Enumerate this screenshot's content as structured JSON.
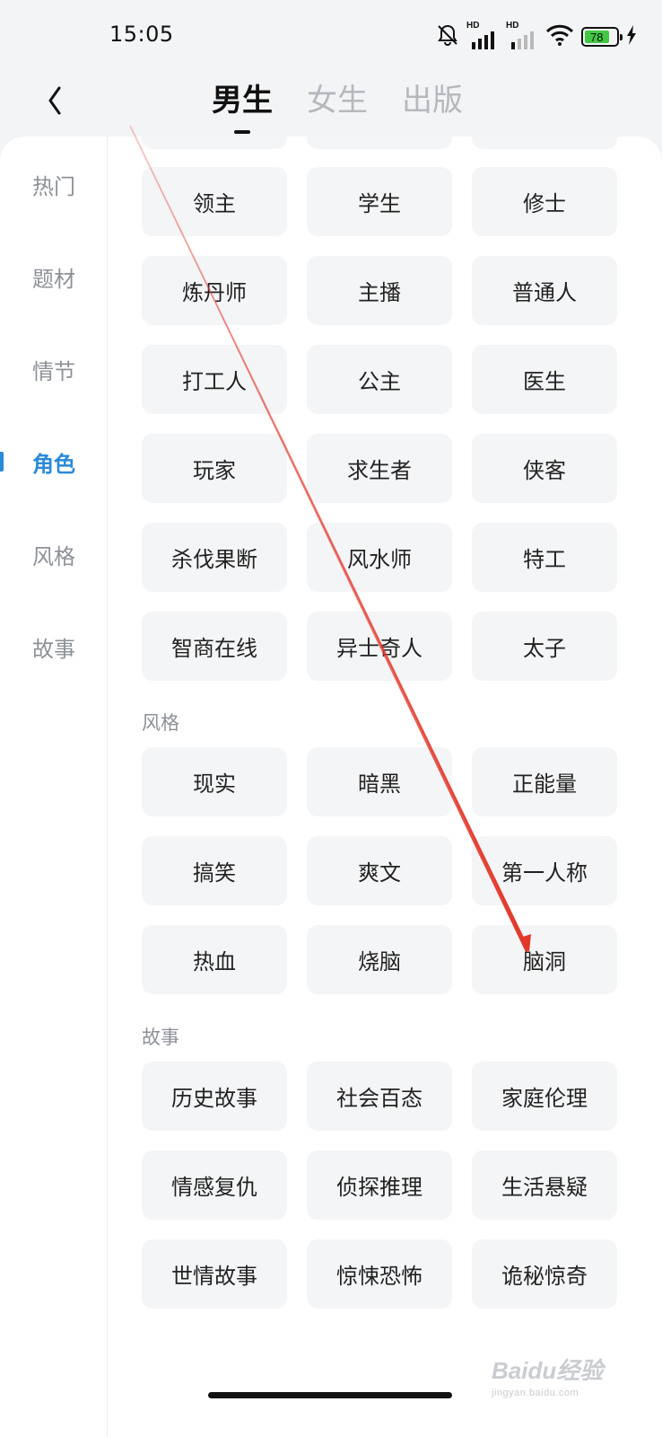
{
  "status_bar": {
    "time": "15:05",
    "signal_label_1": "HD",
    "signal_label_2": "HD",
    "battery_level": "78",
    "icons": [
      "silent-bell-icon",
      "signal-icon",
      "signal-icon",
      "wifi-icon",
      "battery-icon",
      "charging-icon"
    ]
  },
  "header": {
    "back_icon": "chevron-left-icon",
    "tabs": [
      {
        "label": "男生",
        "active": true
      },
      {
        "label": "女生",
        "active": false
      },
      {
        "label": "出版",
        "active": false
      }
    ]
  },
  "sidebar": {
    "items": [
      {
        "label": "热门",
        "active": false
      },
      {
        "label": "题材",
        "active": false
      },
      {
        "label": "情节",
        "active": false
      },
      {
        "label": "角色",
        "active": true
      },
      {
        "label": "风格",
        "active": false
      },
      {
        "label": "故事",
        "active": false
      }
    ],
    "active_color": "#2b8ad8"
  },
  "sections": {
    "roles": {
      "tags": [
        "领主",
        "学生",
        "修士",
        "炼丹师",
        "主播",
        "普通人",
        "打工人",
        "公主",
        "医生",
        "玩家",
        "求生者",
        "侠客",
        "杀伐果断",
        "风水师",
        "特工",
        "智商在线",
        "异士奇人",
        "太子"
      ]
    },
    "style": {
      "title": "风格",
      "tags": [
        "现实",
        "暗黑",
        "正能量",
        "搞笑",
        "爽文",
        "第一人称",
        "热血",
        "烧脑",
        "脑洞"
      ]
    },
    "story": {
      "title": "故事",
      "tags": [
        "历史故事",
        "社会百态",
        "家庭伦理",
        "情感复仇",
        "侦探推理",
        "生活悬疑",
        "世情故事",
        "惊悚恐怖",
        "诡秘惊奇"
      ]
    }
  },
  "annotation": {
    "arrow_color": "#e2382b"
  },
  "watermark": {
    "brand": "Baidu经验",
    "url": "jingyan.baidu.com"
  }
}
